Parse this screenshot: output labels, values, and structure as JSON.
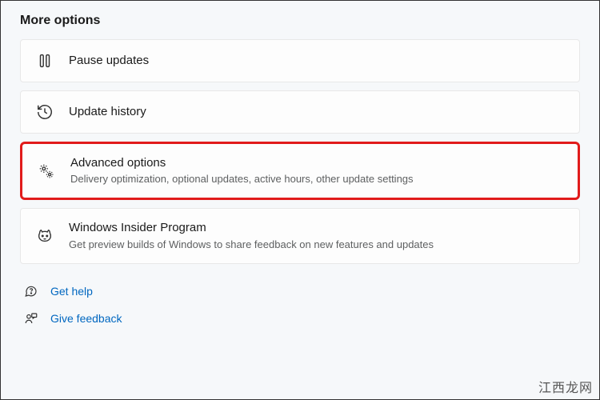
{
  "section": {
    "title": "More options"
  },
  "items": [
    {
      "title": "Pause updates",
      "desc": ""
    },
    {
      "title": "Update history",
      "desc": ""
    },
    {
      "title": "Advanced options",
      "desc": "Delivery optimization, optional updates, active hours, other update settings"
    },
    {
      "title": "Windows Insider Program",
      "desc": "Get preview builds of Windows to share feedback on new features and updates"
    }
  ],
  "footer": {
    "help": "Get help",
    "feedback": "Give feedback"
  },
  "watermark": "江西龙网"
}
